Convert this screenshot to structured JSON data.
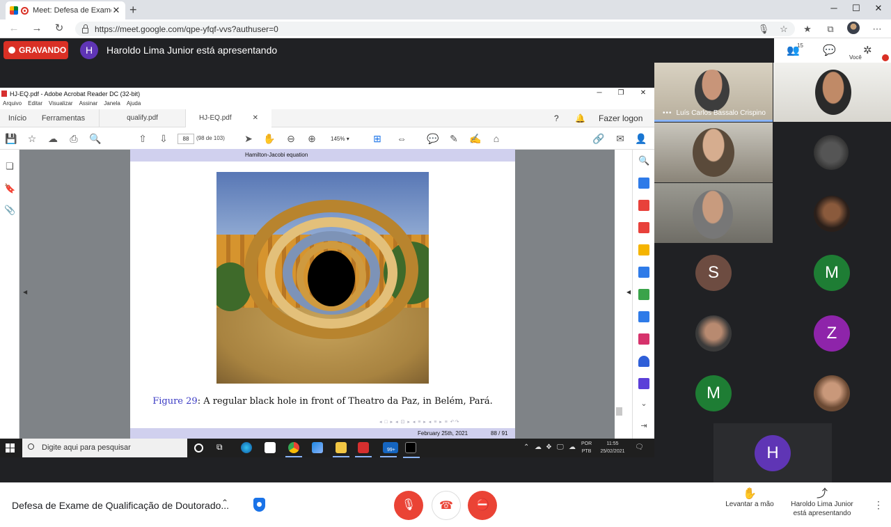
{
  "browser": {
    "tab_title": "Meet: Defesa de Exame de Q",
    "url": "https://meet.google.com/qpe-yfqf-vvs?authuser=0"
  },
  "meet": {
    "recording_label": "GRAVANDO",
    "presenter_initial": "H",
    "presenter_text": "Haroldo Lima Junior está apresentando",
    "participants_count": "15",
    "you_label": "Você",
    "meeting_title": "Defesa de Exame de Qualificação de Doutorado...",
    "raise_hand_label": "Levantar a mão",
    "presenting_label_line1": "Haroldo Lima Junior",
    "presenting_label_line2": "está apresentando"
  },
  "participants": [
    {
      "name": "Luís Carlos Bassalo Crispino",
      "kind": "video"
    },
    {
      "initial": "S",
      "color": "#6d4c41"
    },
    {
      "initial": "M",
      "color": "#1e7d34"
    },
    {
      "initial": "Z",
      "color": "#8e24aa"
    },
    {
      "initial": "M",
      "color": "#1e7d34"
    },
    {
      "initial": "H",
      "color": "#5f35b5"
    }
  ],
  "acrobat": {
    "window_title": "HJ-EQ.pdf - Adobe Acrobat Reader DC (32-bit)",
    "menu": [
      "Arquivo",
      "Editar",
      "Visualizar",
      "Assinar",
      "Janela",
      "Ajuda"
    ],
    "tabs": [
      "Início",
      "Ferramentas"
    ],
    "files": [
      "qualify.pdf",
      "HJ-EQ.pdf"
    ],
    "login_label": "Fazer logon",
    "page_number": "88",
    "page_of": "(98 de 103)",
    "zoom": "145%"
  },
  "pdf": {
    "header": "Hamilton-Jacobi equation",
    "figure_label": "Figure 29",
    "caption": ": A regular black hole in front of Theatro da Paz, in Belém, Pará.",
    "footer_date": "February 25th, 2021",
    "footer_page": "88 / 91"
  },
  "taskbar": {
    "search_placeholder": "Digite aqui para pesquisar",
    "lang_top": "POR",
    "lang_bottom": "PTB",
    "time": "11:55",
    "date": "25/02/2021",
    "mail_badge": "99+"
  }
}
